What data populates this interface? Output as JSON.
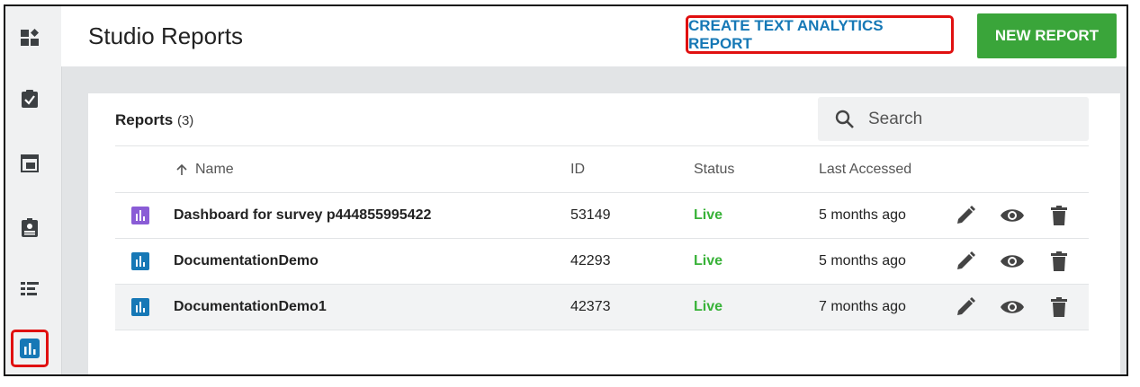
{
  "app": {
    "title": "Studio Reports"
  },
  "sidebar": {
    "items": [
      {
        "icon": "dashboard-add-icon"
      },
      {
        "icon": "clipboard-check-icon"
      },
      {
        "icon": "window-icon"
      },
      {
        "icon": "contact-card-icon"
      },
      {
        "icon": "list-icon"
      },
      {
        "icon": "bar-chart-icon",
        "active": true
      }
    ]
  },
  "header": {
    "create_label": "CREATE TEXT ANALYTICS REPORT",
    "new_label": "NEW REPORT"
  },
  "reports": {
    "heading": "Reports",
    "count": "(3)",
    "search_placeholder": "Search",
    "columns": {
      "name": "Name",
      "id": "ID",
      "status": "Status",
      "last_accessed": "Last Accessed"
    },
    "rows": [
      {
        "name": "Dashboard for survey p444855995422",
        "id": "53149",
        "status": "Live",
        "last_accessed": "5 months ago",
        "icon_color": "#8a5cd6"
      },
      {
        "name": "DocumentationDemo",
        "id": "42293",
        "status": "Live",
        "last_accessed": "5 months ago",
        "icon_color": "#1678b6"
      },
      {
        "name": "DocumentationDemo1",
        "id": "42373",
        "status": "Live",
        "last_accessed": "7 months ago",
        "icon_color": "#1678b6"
      }
    ]
  },
  "colors": {
    "accent": "#1678b6",
    "primary_button": "#3aa53a",
    "live": "#38b238",
    "highlight": "#e01010"
  }
}
